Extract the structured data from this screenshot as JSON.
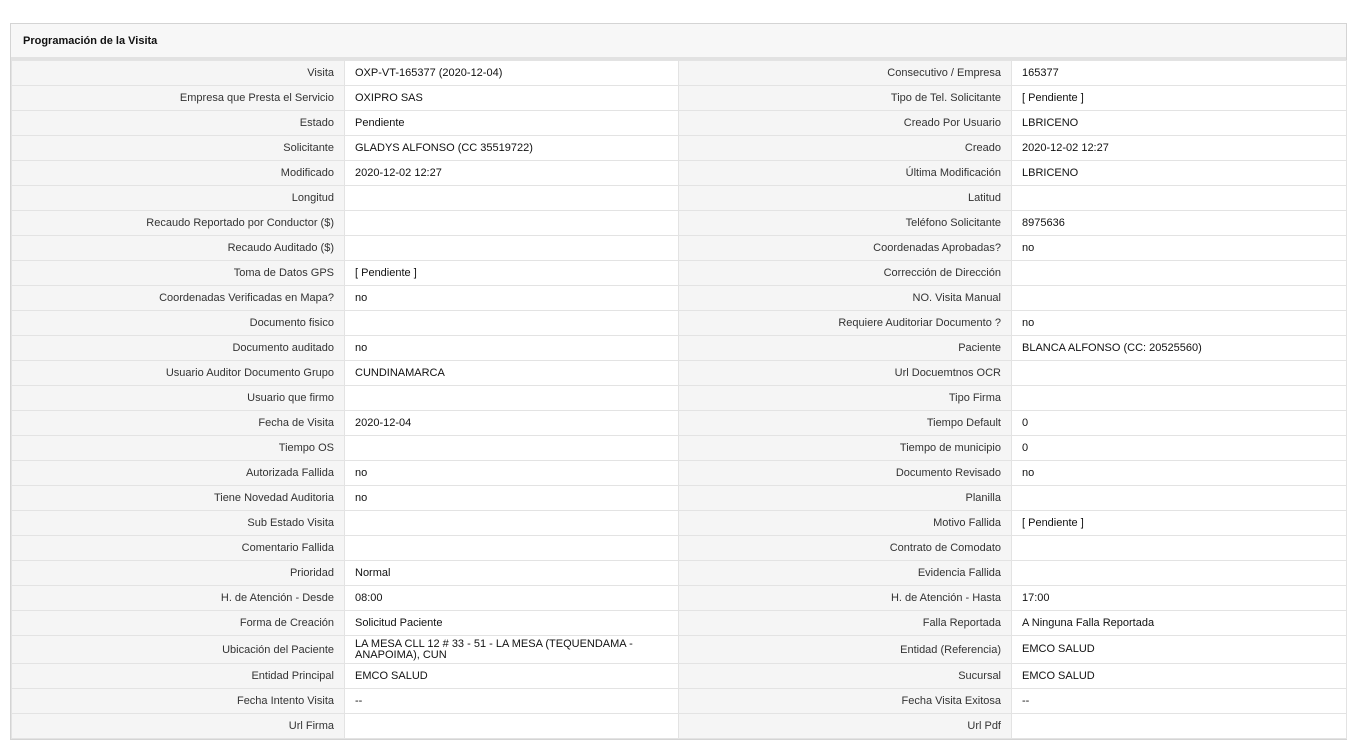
{
  "panel": {
    "title": "Programación de la Visita"
  },
  "rows": [
    {
      "l1": "Visita",
      "v1": "OXP-VT-165377 (2020-12-04)",
      "l2": "Consecutivo / Empresa",
      "v2": "165377"
    },
    {
      "l1": "Empresa que Presta el Servicio",
      "v1": "OXIPRO SAS",
      "l2": "Tipo de Tel. Solicitante",
      "v2": "[ Pendiente ]"
    },
    {
      "l1": "Estado",
      "v1": "Pendiente",
      "l2": "Creado Por Usuario",
      "v2": "LBRICENO"
    },
    {
      "l1": "Solicitante",
      "v1": "GLADYS ALFONSO (CC 35519722)",
      "l2": "Creado",
      "v2": "2020-12-02 12:27"
    },
    {
      "l1": "Modificado",
      "v1": "2020-12-02 12:27",
      "l2": "Última Modificación",
      "v2": " LBRICENO"
    },
    {
      "l1": "Longitud",
      "v1": "",
      "l2": "Latitud",
      "v2": ""
    },
    {
      "l1": "Recaudo Reportado por Conductor ($)",
      "v1": "",
      "l2": "Teléfono Solicitante",
      "v2": "8975636"
    },
    {
      "l1": "Recaudo Auditado ($)",
      "v1": "",
      "l2": "Coordenadas Aprobadas?",
      "v2": " no"
    },
    {
      "l1": "Toma de Datos GPS",
      "v1": "[ Pendiente ]",
      "l2": "Corrección de Dirección",
      "v2": ""
    },
    {
      "l1": "Coordenadas Verificadas en Mapa?",
      "v1": " no",
      "l2": "NO. Visita Manual",
      "v2": ""
    },
    {
      "l1": "Documento fisico",
      "v1": "",
      "l2": "Requiere Auditoriar Documento ?",
      "v2": " no"
    },
    {
      "l1": "Documento auditado",
      "v1": " no",
      "l2": "Paciente",
      "v2": "BLANCA ALFONSO (CC: 20525560)"
    },
    {
      "l1": "Usuario Auditor Documento Grupo",
      "v1": "CUNDINAMARCA",
      "l2": "Url Docuemtnos OCR",
      "v2": ""
    },
    {
      "l1": "Usuario que firmo",
      "v1": "",
      "l2": "Tipo Firma",
      "v2": ""
    },
    {
      "l1": "Fecha de Visita",
      "v1": " 2020-12-04",
      "l2": "Tiempo Default",
      "v2": "0"
    },
    {
      "l1": "Tiempo OS",
      "v1": "",
      "l2": "Tiempo de municipio",
      "v2": "0"
    },
    {
      "l1": "Autorizada Fallida",
      "v1": " no",
      "l2": "Documento Revisado",
      "v2": " no"
    },
    {
      "l1": "Tiene Novedad Auditoria",
      "v1": " no",
      "l2": "Planilla",
      "v2": ""
    },
    {
      "l1": "Sub Estado Visita",
      "v1": "",
      "l2": "Motivo Fallida",
      "v2": "[ Pendiente ]"
    },
    {
      "l1": "Comentario Fallida",
      "v1": "",
      "l2": "Contrato de Comodato",
      "v2": ""
    },
    {
      "l1": "Prioridad",
      "v1": "Normal",
      "l2": "Evidencia Fallida",
      "v2": ""
    },
    {
      "l1": "H. de Atención - Desde",
      "v1": "08:00",
      "l2": "H. de Atención - Hasta",
      "v2": "17:00"
    },
    {
      "l1": "Forma de Creación",
      "v1": "Solicitud Paciente",
      "l2": "Falla Reportada",
      "v2": "A Ninguna Falla Reportada"
    },
    {
      "l1": "Ubicación del Paciente",
      "v1": "LA MESA CLL 12 # 33 - 51 - LA MESA (TEQUENDAMA - ANAPOIMA), CUN",
      "l2": "Entidad (Referencia)",
      "v2": "EMCO SALUD"
    },
    {
      "l1": "Entidad Principal",
      "v1": "EMCO SALUD",
      "l2": "Sucursal",
      "v2": "EMCO SALUD"
    },
    {
      "l1": "Fecha Intento Visita",
      "v1": " --",
      "l2": "Fecha Visita Exitosa",
      "v2": " --"
    },
    {
      "l1": "Url Firma",
      "v1": "",
      "l2": "Url Pdf",
      "v2": ""
    }
  ]
}
